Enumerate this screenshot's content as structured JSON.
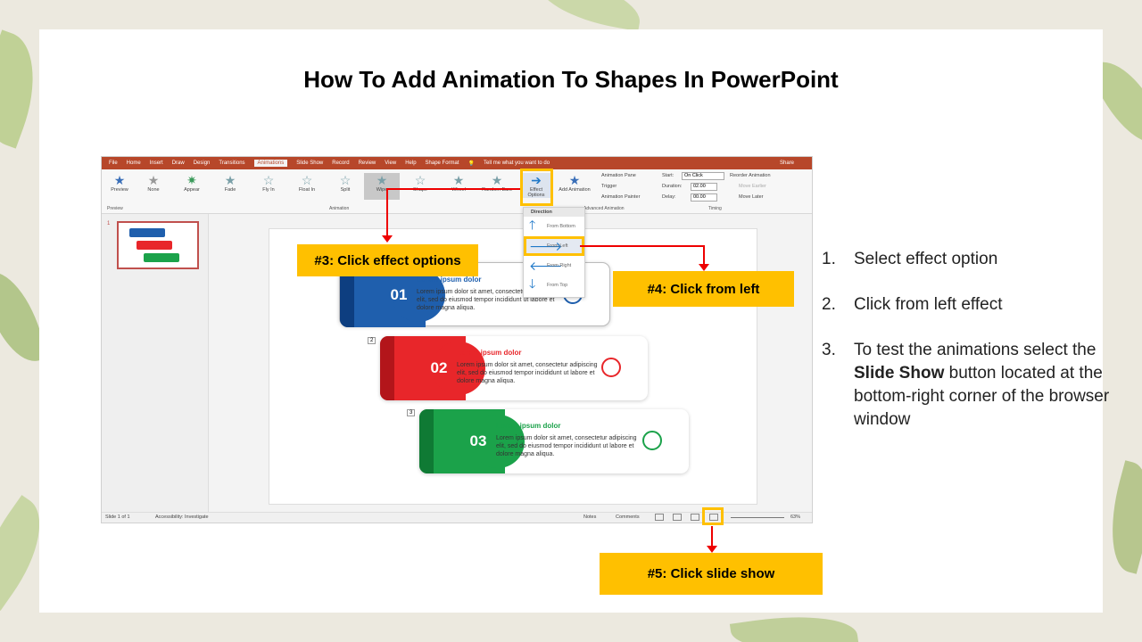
{
  "slide": {
    "title": "How To Add Animation To Shapes In PowerPoint"
  },
  "screenshot": {
    "menu_tabs": [
      "File",
      "Home",
      "Insert",
      "Draw",
      "Design",
      "Transitions",
      "Animations",
      "Slide Show",
      "Record",
      "Review",
      "View",
      "Help",
      "Shape Format"
    ],
    "active_tab": "Animations",
    "tell_me": "Tell me what you want to do",
    "share": "Share",
    "ribbon": {
      "preview": "Preview",
      "effects": [
        "None",
        "Appear",
        "Fade",
        "Fly In",
        "Float In",
        "Split",
        "Wipe",
        "Shape",
        "Wheel",
        "Random Bars"
      ],
      "effect_options": "Effect Options",
      "add_animation": "Add Animation",
      "animation_pane": "Animation Pane",
      "trigger": "Trigger",
      "animation_painter": "Animation Painter",
      "start_label": "Start:",
      "start_value": "On Click",
      "duration_label": "Duration:",
      "duration_value": "02.00",
      "delay_label": "Delay:",
      "delay_value": "00.00",
      "reorder": "Reorder Animation",
      "move_earlier": "Move Earlier",
      "move_later": "Move Later",
      "group_preview": "Preview",
      "group_animation": "Animation",
      "group_advanced": "Advanced Animation",
      "group_timing": "Timing"
    },
    "dropdown": {
      "header": "Direction",
      "items": [
        "From Bottom",
        "From Left",
        "From Right",
        "From Top"
      ]
    },
    "cards": [
      {
        "num": "01",
        "title": "Lorem ipsum dolor",
        "text": "Lorem ipsum dolor sit amet, consectetur adipiscing elit, sed do eiusmod tempor incididunt ut labore et dolore magna aliqua.",
        "color": "#1f5fad",
        "dark": "#0d3e80",
        "title_color": "#1f5fad"
      },
      {
        "num": "02",
        "title": "Lorem ipsum dolor",
        "text": "Lorem ipsum dolor sit amet, consectetur adipiscing elit, sed do eiusmod tempor incididunt ut labore et dolore magna aliqua.",
        "color": "#e8262a",
        "dark": "#b3151a",
        "title_color": "#e8262a"
      },
      {
        "num": "03",
        "title": "Lorem ipsum dolor",
        "text": "Lorem ipsum dolor sit amet, consectetur adipiscing elit, sed do eiusmod tempor incididunt ut labore et dolore magna aliqua.",
        "color": "#1ba24a",
        "dark": "#0f7a34",
        "title_color": "#1ba24a"
      }
    ],
    "card_tags": [
      "2",
      "3"
    ],
    "slide_number": "1",
    "status": {
      "slide_of": "Slide 1 of 1",
      "accessibility": "Accessibility: Investigate",
      "notes": "Notes",
      "comments": "Comments",
      "zoom": "63%"
    }
  },
  "callouts": {
    "effect_options": "#3: Click effect options",
    "from_left": "#4: Click from left",
    "slide_show": "#5: Click slide show"
  },
  "steps": [
    {
      "n": "1.",
      "text": "Select effect option"
    },
    {
      "n": "2.",
      "text": "Click from left effect"
    },
    {
      "n": "3.",
      "pre": "To test the animations select the ",
      "bold": "Slide Show",
      "post": " button located at the bottom-right  corner of the browser window"
    }
  ],
  "colors": {
    "callout": "#ffc000",
    "arrow": "#e00000",
    "menubar": "#b7472a"
  }
}
